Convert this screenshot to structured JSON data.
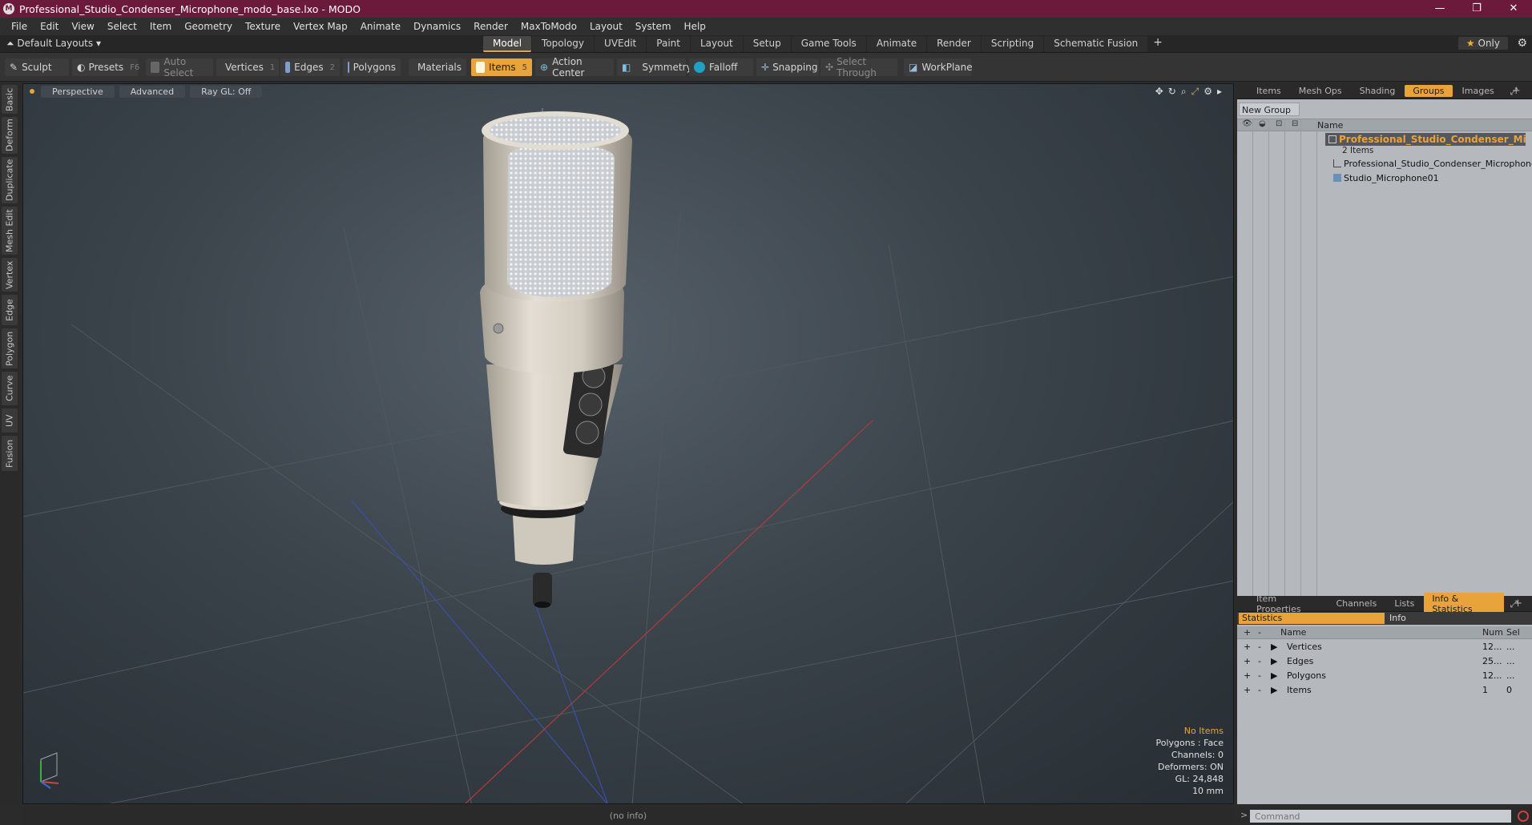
{
  "window": {
    "title": "Professional_Studio_Condenser_Microphone_modo_base.lxo - MODO",
    "app_icon": "modo-logo",
    "controls": [
      "—",
      "❐",
      "✕"
    ]
  },
  "menu": [
    "File",
    "Edit",
    "View",
    "Select",
    "Item",
    "Geometry",
    "Texture",
    "Vertex Map",
    "Animate",
    "Dynamics",
    "Render",
    "MaxToModo",
    "Layout",
    "System",
    "Help"
  ],
  "layouts": {
    "default_label": "Default Layouts ▾",
    "tabs": [
      "Model",
      "Topology",
      "UVEdit",
      "Paint",
      "Layout",
      "Setup",
      "Game Tools",
      "Animate",
      "Render",
      "Scripting",
      "Schematic Fusion"
    ],
    "active_tab": "Model",
    "add": "+",
    "only_label": "Only"
  },
  "toolbar": {
    "sculpt": "Sculpt",
    "presets": "Presets",
    "presets_key": "F6",
    "auto_select": "Auto Select",
    "vertices": "Vertices",
    "vertices_key": "1",
    "edges": "Edges",
    "edges_key": "2",
    "polygons": "Polygons",
    "materials": "Materials",
    "items": "Items",
    "items_key": "5",
    "action_center": "Action Center",
    "symmetry": "Symmetry",
    "falloff": "Falloff",
    "snapping": "Snapping",
    "select_through": "Select Through",
    "workplane": "WorkPlane"
  },
  "left_tabs": [
    "Basic",
    "Deform",
    "Duplicate",
    "Mesh Edit",
    "Vertex",
    "Edge",
    "Polygon",
    "Curve",
    "UV",
    "Fusion"
  ],
  "viewport": {
    "view_mode": "Perspective",
    "shading": "Advanced",
    "raygl": "Ray GL: Off",
    "stats": {
      "items": "No Items",
      "polygons": "Polygons : Face",
      "channels": "Channels: 0",
      "deformers": "Deformers: ON",
      "gl": "GL: 24,848",
      "scale": "10 mm"
    }
  },
  "status": "(no info)",
  "groups_panel": {
    "tabs": [
      "Items",
      "Mesh Ops",
      "Shading",
      "Groups",
      "Images"
    ],
    "active_tab": "Groups",
    "new_group": "New Group",
    "name_header": "Name",
    "group_name": "Professional_Studio_Condenser_Micro...",
    "group_count": "2 Items",
    "children": [
      "Professional_Studio_Condenser_Microphone",
      "Studio_Microphone01"
    ]
  },
  "info_panel": {
    "tabs": [
      "Item Properties",
      "Channels",
      "Lists",
      "Info & Statistics"
    ],
    "active_tab": "Info & Statistics",
    "sub_statistics": "Statistics",
    "sub_info": "Info",
    "headers": {
      "name": "Name",
      "num": "Num",
      "sel": "Sel"
    },
    "rows": [
      {
        "name": "Vertices",
        "num": "12...",
        "sel": "..."
      },
      {
        "name": "Edges",
        "num": "25...",
        "sel": "..."
      },
      {
        "name": "Polygons",
        "num": "12...",
        "sel": "..."
      },
      {
        "name": "Items",
        "num": "1",
        "sel": "0"
      }
    ]
  },
  "command": {
    "placeholder": "Command",
    "prompt": ">"
  },
  "colors": {
    "accent": "#e8a43a",
    "titlebar": "#6b1a3b"
  }
}
